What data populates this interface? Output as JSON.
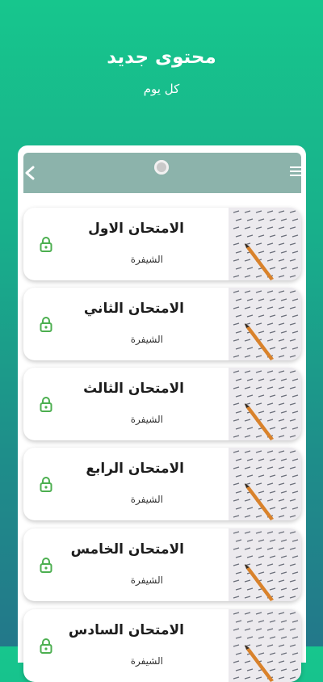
{
  "promo": {
    "headline": "محتوى جديد",
    "subline": "كل يوم"
  },
  "appbar": {
    "back_icon": "chevron-left-icon",
    "menu_icon": "hamburger-menu-icon"
  },
  "exams": [
    {
      "title": "الامتحان الاول",
      "code_label": "الشيفرة",
      "icon": "lock-icon",
      "locked": true
    },
    {
      "title": "الامتحان الثاني",
      "code_label": "الشيفرة",
      "icon": "lock-icon",
      "locked": true
    },
    {
      "title": "الامتحان الثالث",
      "code_label": "الشيفرة",
      "icon": "lock-icon",
      "locked": true
    },
    {
      "title": "الامتحان الرابع",
      "code_label": "الشيفرة",
      "icon": "lock-icon",
      "locked": true
    },
    {
      "title": "الامتحان الخامس",
      "code_label": "الشيفرة",
      "icon": "lock-icon",
      "locked": true
    },
    {
      "title": "الامتحان السادس",
      "code_label": "الشيفرة",
      "icon": "lock-icon",
      "locked": true
    }
  ],
  "colors": {
    "accent_green": "#17c68d",
    "lock_green": "#4caf50",
    "appbar": "#8cb3ab"
  }
}
